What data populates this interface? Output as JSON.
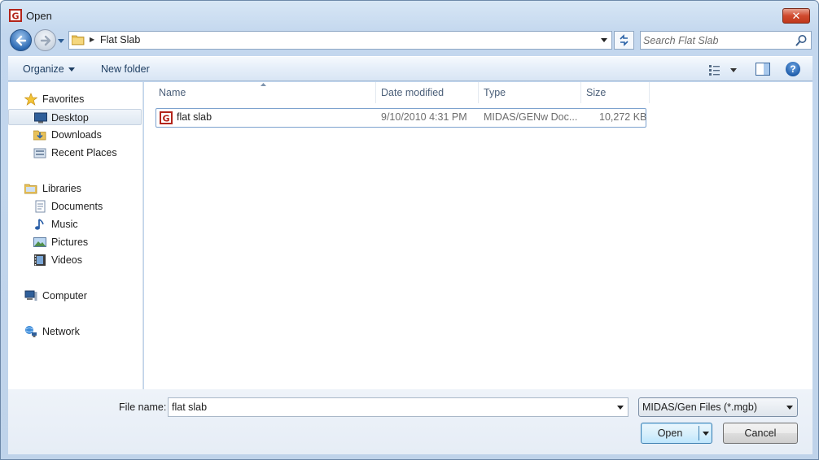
{
  "window": {
    "title": "Open",
    "close_label": "✕"
  },
  "address": {
    "breadcrumb": "Flat Slab"
  },
  "search": {
    "placeholder": "Search Flat Slab"
  },
  "toolbar": {
    "organize_label": "Organize",
    "new_folder_label": "New folder"
  },
  "nav": {
    "favorites": "Favorites",
    "desktop": "Desktop",
    "downloads": "Downloads",
    "recent_places": "Recent Places",
    "libraries": "Libraries",
    "documents": "Documents",
    "music": "Music",
    "pictures": "Pictures",
    "videos": "Videos",
    "computer": "Computer",
    "network": "Network"
  },
  "columns": {
    "name": "Name",
    "date_modified": "Date modified",
    "type": "Type",
    "size": "Size"
  },
  "files": [
    {
      "name": "flat slab",
      "date_modified": "9/10/2010 4:31 PM",
      "type": "MIDAS/GENw Doc...",
      "size": "10,272 KB"
    }
  ],
  "bottom": {
    "file_name_label": "File name:",
    "file_name_value": "flat slab",
    "filter_value": "MIDAS/Gen Files (*.mgb)",
    "open_label": "Open",
    "cancel_label": "Cancel"
  },
  "colors": {
    "accent": "#2d6ab3",
    "selection_border": "#7da2ce"
  }
}
